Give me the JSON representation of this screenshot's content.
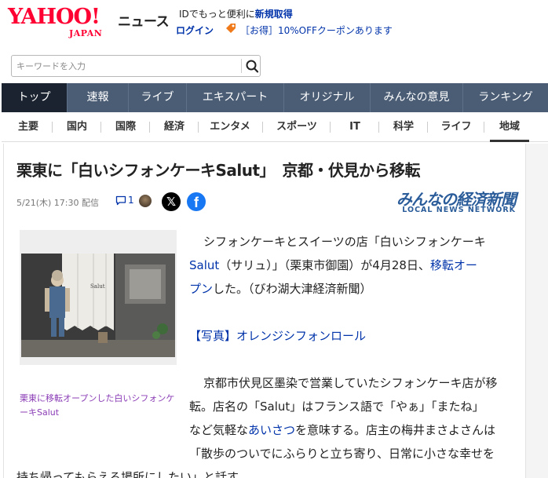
{
  "header": {
    "logo_yahoo": "YAHOO!",
    "logo_japan": "JAPAN",
    "logo_news": "ニュース",
    "promo_prefix": "IDでもっと便利に",
    "promo_link": "新規取得",
    "login_label": "ログイン",
    "coupon_text": "［お得］10%OFFクーポンあります",
    "brand_color": "#ff0033"
  },
  "search": {
    "placeholder": "キーワードを入力",
    "button_icon": "search-icon"
  },
  "main_nav": {
    "tabs": [
      {
        "label": "トップ"
      },
      {
        "label": "速報"
      },
      {
        "label": "ライブ"
      },
      {
        "label": "エキスパート"
      },
      {
        "label": "オリジナル"
      },
      {
        "label": "みんなの意見"
      },
      {
        "label": "ランキング"
      }
    ],
    "active": "トップ",
    "bg_color": "#4a5d75",
    "active_color": "#1c2330"
  },
  "sub_nav": {
    "tabs": [
      {
        "label": "主要"
      },
      {
        "label": "国内"
      },
      {
        "label": "国際"
      },
      {
        "label": "経済"
      },
      {
        "label": "エンタメ"
      },
      {
        "label": "スポーツ"
      },
      {
        "label": "IT"
      },
      {
        "label": "科学"
      },
      {
        "label": "ライフ"
      },
      {
        "label": "地域"
      }
    ],
    "active": "地域"
  },
  "article": {
    "title": "栗東に「白いシフォンケーキSalut」　京都・伏見から移転",
    "date": "5/21(木) 17:30 配信",
    "comment_count": "1",
    "x_icon_label": "𝕏",
    "fb_icon_label": "f",
    "source_logo_main": "みんなの経済新聞",
    "source_logo_sub": "LOCAL NEWS NETWORK",
    "photo_caption": "栗東に移転オープンした白いシフォンケーキSalut",
    "photo_sign": "Salut",
    "body": {
      "p1_l1": "シフォンケーキとスイーツの店「白いシフォンケーキ",
      "p1_l2_link1": "Salut",
      "p1_l2_text": "（サリュ）」（栗東市御園）が4月28日、",
      "p1_l2_link2": "移転オー",
      "p1_l3_link": "プン",
      "p1_l3_text": "した。（びわ湖大津経済新聞）",
      "photo_link": "【写真】オレンジシフォンロール",
      "p2_l1": "京都市伏見区墨染で営業していたシフォンケーキ店が移",
      "p2_l2": "転。店名の「Salut」はフランス語で「やぁ」「またね」",
      "p2_l3_pre": "など気軽な",
      "p2_l3_link": "あいさつ",
      "p2_l3_post": "を意味する。店主の梅井まさよさんは",
      "p2_l4": "「散歩のついでにふらりと立ち寄り、日常に小さな幸せを",
      "p2_l5": "持ち帰ってもらえる場所にしたい」と話す。"
    }
  }
}
